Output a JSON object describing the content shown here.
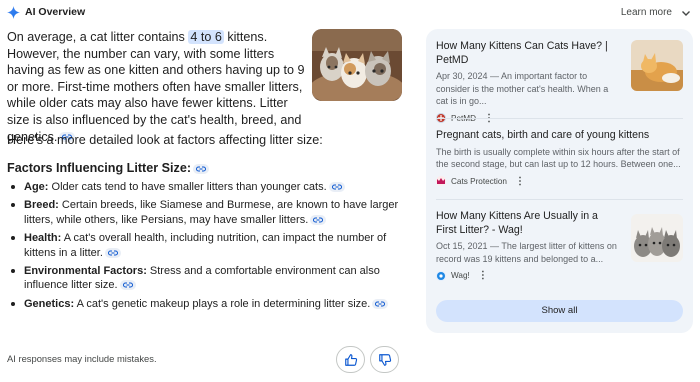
{
  "header": {
    "title": "AI Overview",
    "learn_more": "Learn more"
  },
  "main": {
    "intro_before": "On average, a cat litter contains ",
    "intro_highlight": "4 to 6",
    "intro_after": " kittens. However, the number can vary, with some litters having as few as one kitten and others having up to 9 or more. First-time mothers often have smaller litters, while older cats may also have fewer kittens. Litter size is also influenced by the cat's health, breed, and genetics.",
    "para2": "Here's a more detailed look at factors affecting litter size:",
    "subhead": "Factors Influencing Litter Size:",
    "factors": [
      {
        "term": "Age:",
        "text": " Older cats tend to have smaller litters than younger cats."
      },
      {
        "term": "Breed:",
        "text": " Certain breeds, like Siamese and Burmese, are known to have larger litters, while others, like Persians, may have smaller litters."
      },
      {
        "term": "Health:",
        "text": " A cat's overall health, including nutrition, can impact the number of kittens in a litter."
      },
      {
        "term": "Environmental Factors:",
        "text": " Stress and a comfortable environment can also influence litter size."
      },
      {
        "term": "Genetics:",
        "text": " A cat's genetic makeup plays a role in determining litter size."
      }
    ],
    "disclaimer": "AI responses may include mistakes."
  },
  "sources": [
    {
      "title": "How Many Kittens Can Cats Have? | PetMD",
      "desc": "Apr 30, 2024 — An important factor to consider is the mother cat's health. When a cat is in go...",
      "site": "PetMD"
    },
    {
      "title": "Pregnant cats, birth and care of young kittens",
      "desc": "The birth is usually complete within six hours after the start of the second stage, but can last up to 12 hours. Between one...",
      "site": "Cats Protection"
    },
    {
      "title": "How Many Kittens Are Usually in a First Litter? - Wag!",
      "desc": "Oct 15, 2021 — The largest litter of kittens on record was 19 kittens and belonged to a...",
      "site": "Wag!"
    }
  ],
  "show_all": "Show all",
  "colors": {
    "accent": "#0b57d0",
    "highlight": "#d3e3fd",
    "panel_bg": "#f0f4f9"
  }
}
